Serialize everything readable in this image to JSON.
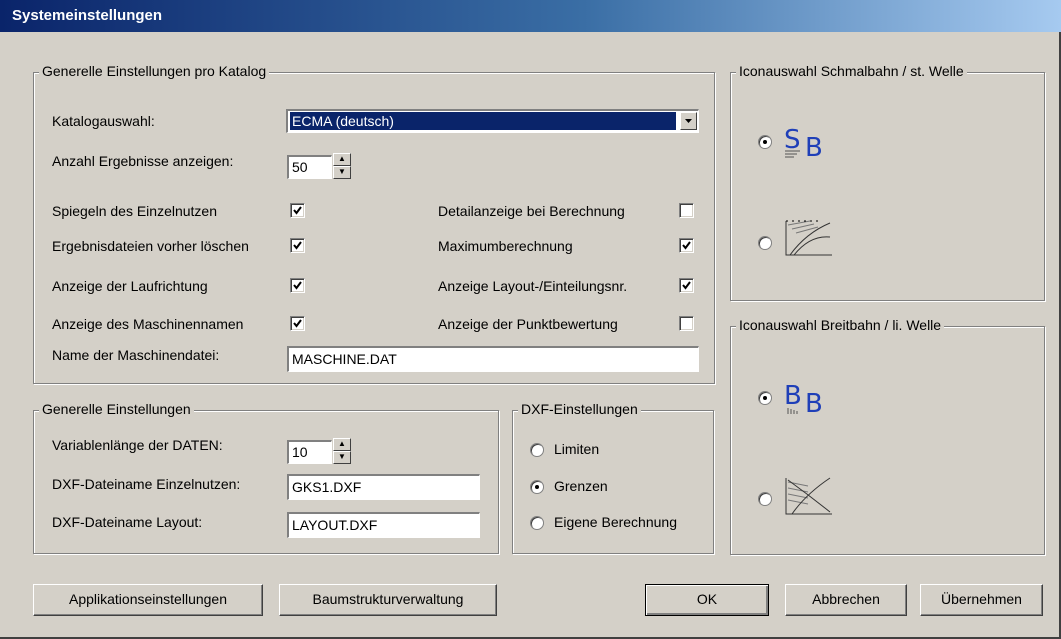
{
  "window": {
    "title": "Systemeinstellungen"
  },
  "catalog_group": {
    "legend": "Generelle Einstellungen pro Katalog",
    "katalog_label": "Katalogauswahl:",
    "katalog_value": "ECMA (deutsch)",
    "anzahl_label": "Anzahl Ergebnisse anzeigen:",
    "anzahl_value": "50",
    "checks": [
      {
        "label": "Spiegeln des Einzelnutzen",
        "checked": true
      },
      {
        "label": "Ergebnisdateien vorher löschen",
        "checked": true
      },
      {
        "label": "Anzeige der Laufrichtung",
        "checked": true
      },
      {
        "label": "Anzeige des Maschinennamen",
        "checked": true
      },
      {
        "label": "Detailanzeige bei Berechnung",
        "checked": false
      },
      {
        "label": "Maximumberechnung",
        "checked": true
      },
      {
        "label": "Anzeige Layout-/Einteilungsnr.",
        "checked": true
      },
      {
        "label": "Anzeige der Punktbewertung",
        "checked": false
      }
    ],
    "maschinendatei_label": "Name der Maschinendatei:",
    "maschinendatei_value": "MASCHINE.DAT"
  },
  "general_group": {
    "legend": "Generelle Einstellungen",
    "var_label": "Variablenlänge der DATEN:",
    "var_value": "10",
    "dxf_einzel_label": "DXF-Dateiname Einzelnutzen:",
    "dxf_einzel_value": "GKS1.DXF",
    "dxf_layout_label": "DXF-Dateiname Layout:",
    "dxf_layout_value": "LAYOUT.DXF"
  },
  "dxf_group": {
    "legend": "DXF-Einstellungen",
    "options": [
      "Limiten",
      "Grenzen",
      "Eigene Berechnung"
    ],
    "selected": "Grenzen"
  },
  "icon_schmal": {
    "legend": "Iconauswahl Schmalbahn / st. Welle",
    "selected": 0
  },
  "icon_breit": {
    "legend": "Iconauswahl Breitbahn / li. Welle",
    "selected": 0
  },
  "buttons": {
    "applikation": "Applikationseinstellungen",
    "baum": "Baumstrukturverwaltung",
    "ok": "OK",
    "abbrechen": "Abbrechen",
    "uebernehmen": "Übernehmen"
  },
  "colors": {
    "icon_blue": "#1f3fb8",
    "selection": "#0a246a"
  }
}
